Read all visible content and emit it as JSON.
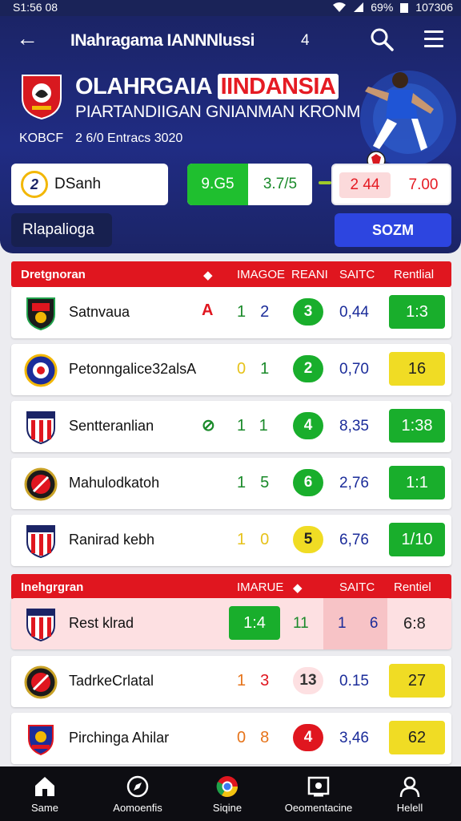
{
  "status": {
    "time": "S1:56 08",
    "battery": "69%",
    "clock": "107306"
  },
  "topbar": {
    "title": "INahragama IANNNlussi",
    "mark": "4"
  },
  "hero": {
    "title_main": "OLAHRGAIA",
    "title_accent": "IINDANSIA",
    "subtitle": "PIARTANDIIGAN GNIANMAN KRONM",
    "kode": "KOBCF",
    "date": "2 6/0 Entracs 3020"
  },
  "summary": {
    "team_initial": "2",
    "team_name": "DSanh",
    "score_left": "9.G5",
    "score_right": "3.7/5",
    "odds_left": "2 44",
    "odds_right": "7.00",
    "chip_label": "Rlapalioga",
    "cta_label": "SOZM"
  },
  "table1": {
    "headers": [
      "Dretgnoran",
      "◆",
      "IMAGOE",
      "REANI",
      "SAITC",
      "Rentlial"
    ],
    "rows": [
      {
        "name": "Satnvaua",
        "mark": "A",
        "markColor": "#e0161f",
        "score": "1 2",
        "scoreColors": [
          "#1a8a2a",
          "#1b2c9a"
        ],
        "circle": "3",
        "circleBg": "#19ae2c",
        "circleFg": "#fff",
        "odd": "0,44",
        "result": "1:3",
        "resultStyle": "green",
        "logo": "shield-red"
      },
      {
        "name": "Petonngalice32alsA",
        "mark": "",
        "markColor": "#1a8a2a",
        "score": "0 1",
        "scoreColors": [
          "#e6c21a",
          "#1a8a2a"
        ],
        "circle": "2",
        "circleBg": "#19ae2c",
        "circleFg": "#fff",
        "odd": "0,70",
        "result": "16",
        "resultStyle": "yellow",
        "logo": "round-blue"
      },
      {
        "name": "Sentteranlian",
        "mark": "⊘",
        "markColor": "#1a8a2a",
        "score": "1 1",
        "scoreColors": [
          "#1a8a2a",
          "#1a8a2a"
        ],
        "circle": "4",
        "circleBg": "#19ae2c",
        "circleFg": "#fff",
        "odd": "8,35",
        "result": "1:38",
        "resultStyle": "green",
        "logo": "shield-stripe"
      },
      {
        "name": "Mahulodkatoh",
        "mark": "",
        "markColor": "#1a8a2a",
        "score": "1 5",
        "scoreColors": [
          "#1a8a2a",
          "#1a8a2a"
        ],
        "circle": "6",
        "circleBg": "#19ae2c",
        "circleFg": "#fff",
        "odd": "2,76",
        "result": "1:1",
        "resultStyle": "green",
        "logo": "round-red"
      },
      {
        "name": "Ranirad kebh",
        "mark": "",
        "markColor": "#1a8a2a",
        "score": "1 0",
        "scoreColors": [
          "#e6c21a",
          "#e6c21a"
        ],
        "circle": "5",
        "circleBg": "#f0dc24",
        "circleFg": "#222",
        "odd": "6,76",
        "result": "1/10",
        "resultStyle": "green",
        "logo": "shield-stripe"
      }
    ]
  },
  "table2": {
    "headers": [
      "Inehgrgran",
      "IMARUE",
      "◆",
      "SAITC",
      "Rentiel"
    ],
    "rows": [
      {
        "name": "Rest klrad",
        "score": "11",
        "odd": "1 6",
        "result": "6:8",
        "box": "1:4",
        "logo": "shield-stripe"
      },
      {
        "name": "TadrkeCrlatal",
        "score": "1 3",
        "scoreColors": [
          "#e6731a",
          "#e0161f"
        ],
        "circle": "13",
        "circleBg": "#fde0e2",
        "circleFg": "#333",
        "odd": "0.15",
        "result": "27",
        "resultStyle": "yellow",
        "logo": "round-red"
      },
      {
        "name": "Pirchinga Ahilar",
        "score": "0 8",
        "scoreColors": [
          "#e6731a",
          "#e6731a"
        ],
        "circle": "4",
        "circleBg": "#e0161f",
        "circleFg": "#fff",
        "odd": "3,46",
        "result": "62",
        "resultStyle": "yellow",
        "logo": "crest-blue"
      }
    ]
  },
  "nav": [
    {
      "label": "Same",
      "icon": "home-icon"
    },
    {
      "label": "Aomoenfis",
      "icon": "compass-icon"
    },
    {
      "label": "Siqine",
      "icon": "chrome-icon"
    },
    {
      "label": "Oeomentacine",
      "icon": "media-icon"
    },
    {
      "label": "Helell",
      "icon": "profile-icon"
    }
  ]
}
